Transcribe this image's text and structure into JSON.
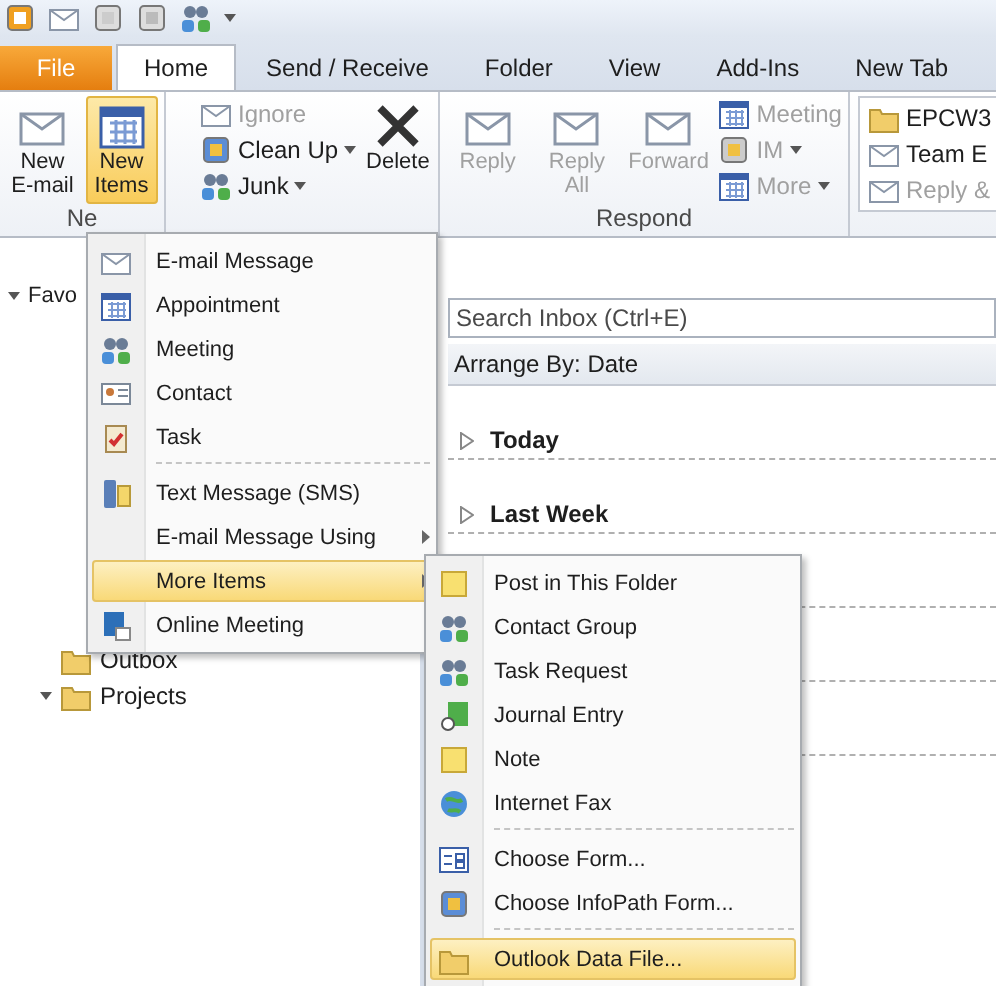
{
  "tabs": [
    {
      "label": "File",
      "kind": "file",
      "selected": false
    },
    {
      "label": "Home",
      "kind": "tab",
      "selected": true
    },
    {
      "label": "Send / Receive",
      "kind": "tab",
      "selected": false
    },
    {
      "label": "Folder",
      "kind": "tab",
      "selected": false
    },
    {
      "label": "View",
      "kind": "tab",
      "selected": false
    },
    {
      "label": "Add-Ins",
      "kind": "tab",
      "selected": false
    },
    {
      "label": "New Tab",
      "kind": "tab",
      "selected": false
    }
  ],
  "ribbon": {
    "new_group": {
      "label": "Ne",
      "buttons": [
        {
          "label": "New E-mail",
          "selected": false
        },
        {
          "label": "New Items",
          "selected": true
        }
      ]
    },
    "delete_group": {
      "small": [
        {
          "label": "Ignore",
          "disabled": true,
          "caret": false
        },
        {
          "label": "Clean Up",
          "disabled": false,
          "caret": true
        },
        {
          "label": "Junk",
          "disabled": false,
          "caret": true
        }
      ],
      "delete": {
        "label": "Delete",
        "disabled": false
      }
    },
    "respond": {
      "label": "Respond",
      "big": [
        {
          "label": "Reply",
          "disabled": true
        },
        {
          "label": "Reply All",
          "disabled": true
        },
        {
          "label": "Forward",
          "disabled": true
        }
      ],
      "small": [
        {
          "label": "Meeting",
          "disabled": true,
          "caret": false
        },
        {
          "label": "IM",
          "disabled": true,
          "caret": true
        },
        {
          "label": "More",
          "disabled": true,
          "caret": true
        }
      ]
    },
    "quick_steps": [
      {
        "label": "EPCW3",
        "disabled": false
      },
      {
        "label": "Team E",
        "disabled": false
      },
      {
        "label": "Reply &",
        "disabled": true
      }
    ]
  },
  "nav": {
    "header": "Favo",
    "folders": [
      {
        "label": "Outbox"
      },
      {
        "label": "Projects",
        "expanded": true
      }
    ]
  },
  "content": {
    "search": {
      "placeholder": "Search Inbox (Ctrl+E)"
    },
    "arrange": "Arrange By: Date",
    "groups": [
      {
        "label": "Today",
        "expanded": false
      },
      {
        "label": "Last Week",
        "expanded": false
      }
    ]
  },
  "menu": {
    "items": [
      {
        "label": "E-mail Message",
        "selected": false,
        "submenu": false
      },
      {
        "label": "Appointment",
        "selected": false,
        "submenu": false
      },
      {
        "label": "Meeting",
        "selected": false,
        "submenu": false
      },
      {
        "label": "Contact",
        "selected": false,
        "submenu": false
      },
      {
        "label": "Task",
        "selected": false,
        "submenu": false,
        "separator_after": true
      },
      {
        "label": "Text Message (SMS)",
        "selected": false,
        "submenu": false
      },
      {
        "label": "E-mail Message Using",
        "selected": false,
        "submenu": true
      },
      {
        "label": "More Items",
        "selected": true,
        "submenu": true
      },
      {
        "label": "Online Meeting",
        "selected": false,
        "submenu": false
      }
    ]
  },
  "submenu": {
    "items": [
      {
        "label": "Post in This Folder",
        "selected": false
      },
      {
        "label": "Contact Group",
        "selected": false
      },
      {
        "label": "Task Request",
        "selected": false
      },
      {
        "label": "Journal Entry",
        "selected": false
      },
      {
        "label": "Note",
        "selected": false
      },
      {
        "label": "Internet Fax",
        "selected": false,
        "separator_after": true
      },
      {
        "label": "Choose Form...",
        "selected": false
      },
      {
        "label": "Choose InfoPath Form...",
        "selected": false,
        "separator_after": true
      },
      {
        "label": "Outlook Data File...",
        "selected": true
      }
    ]
  }
}
